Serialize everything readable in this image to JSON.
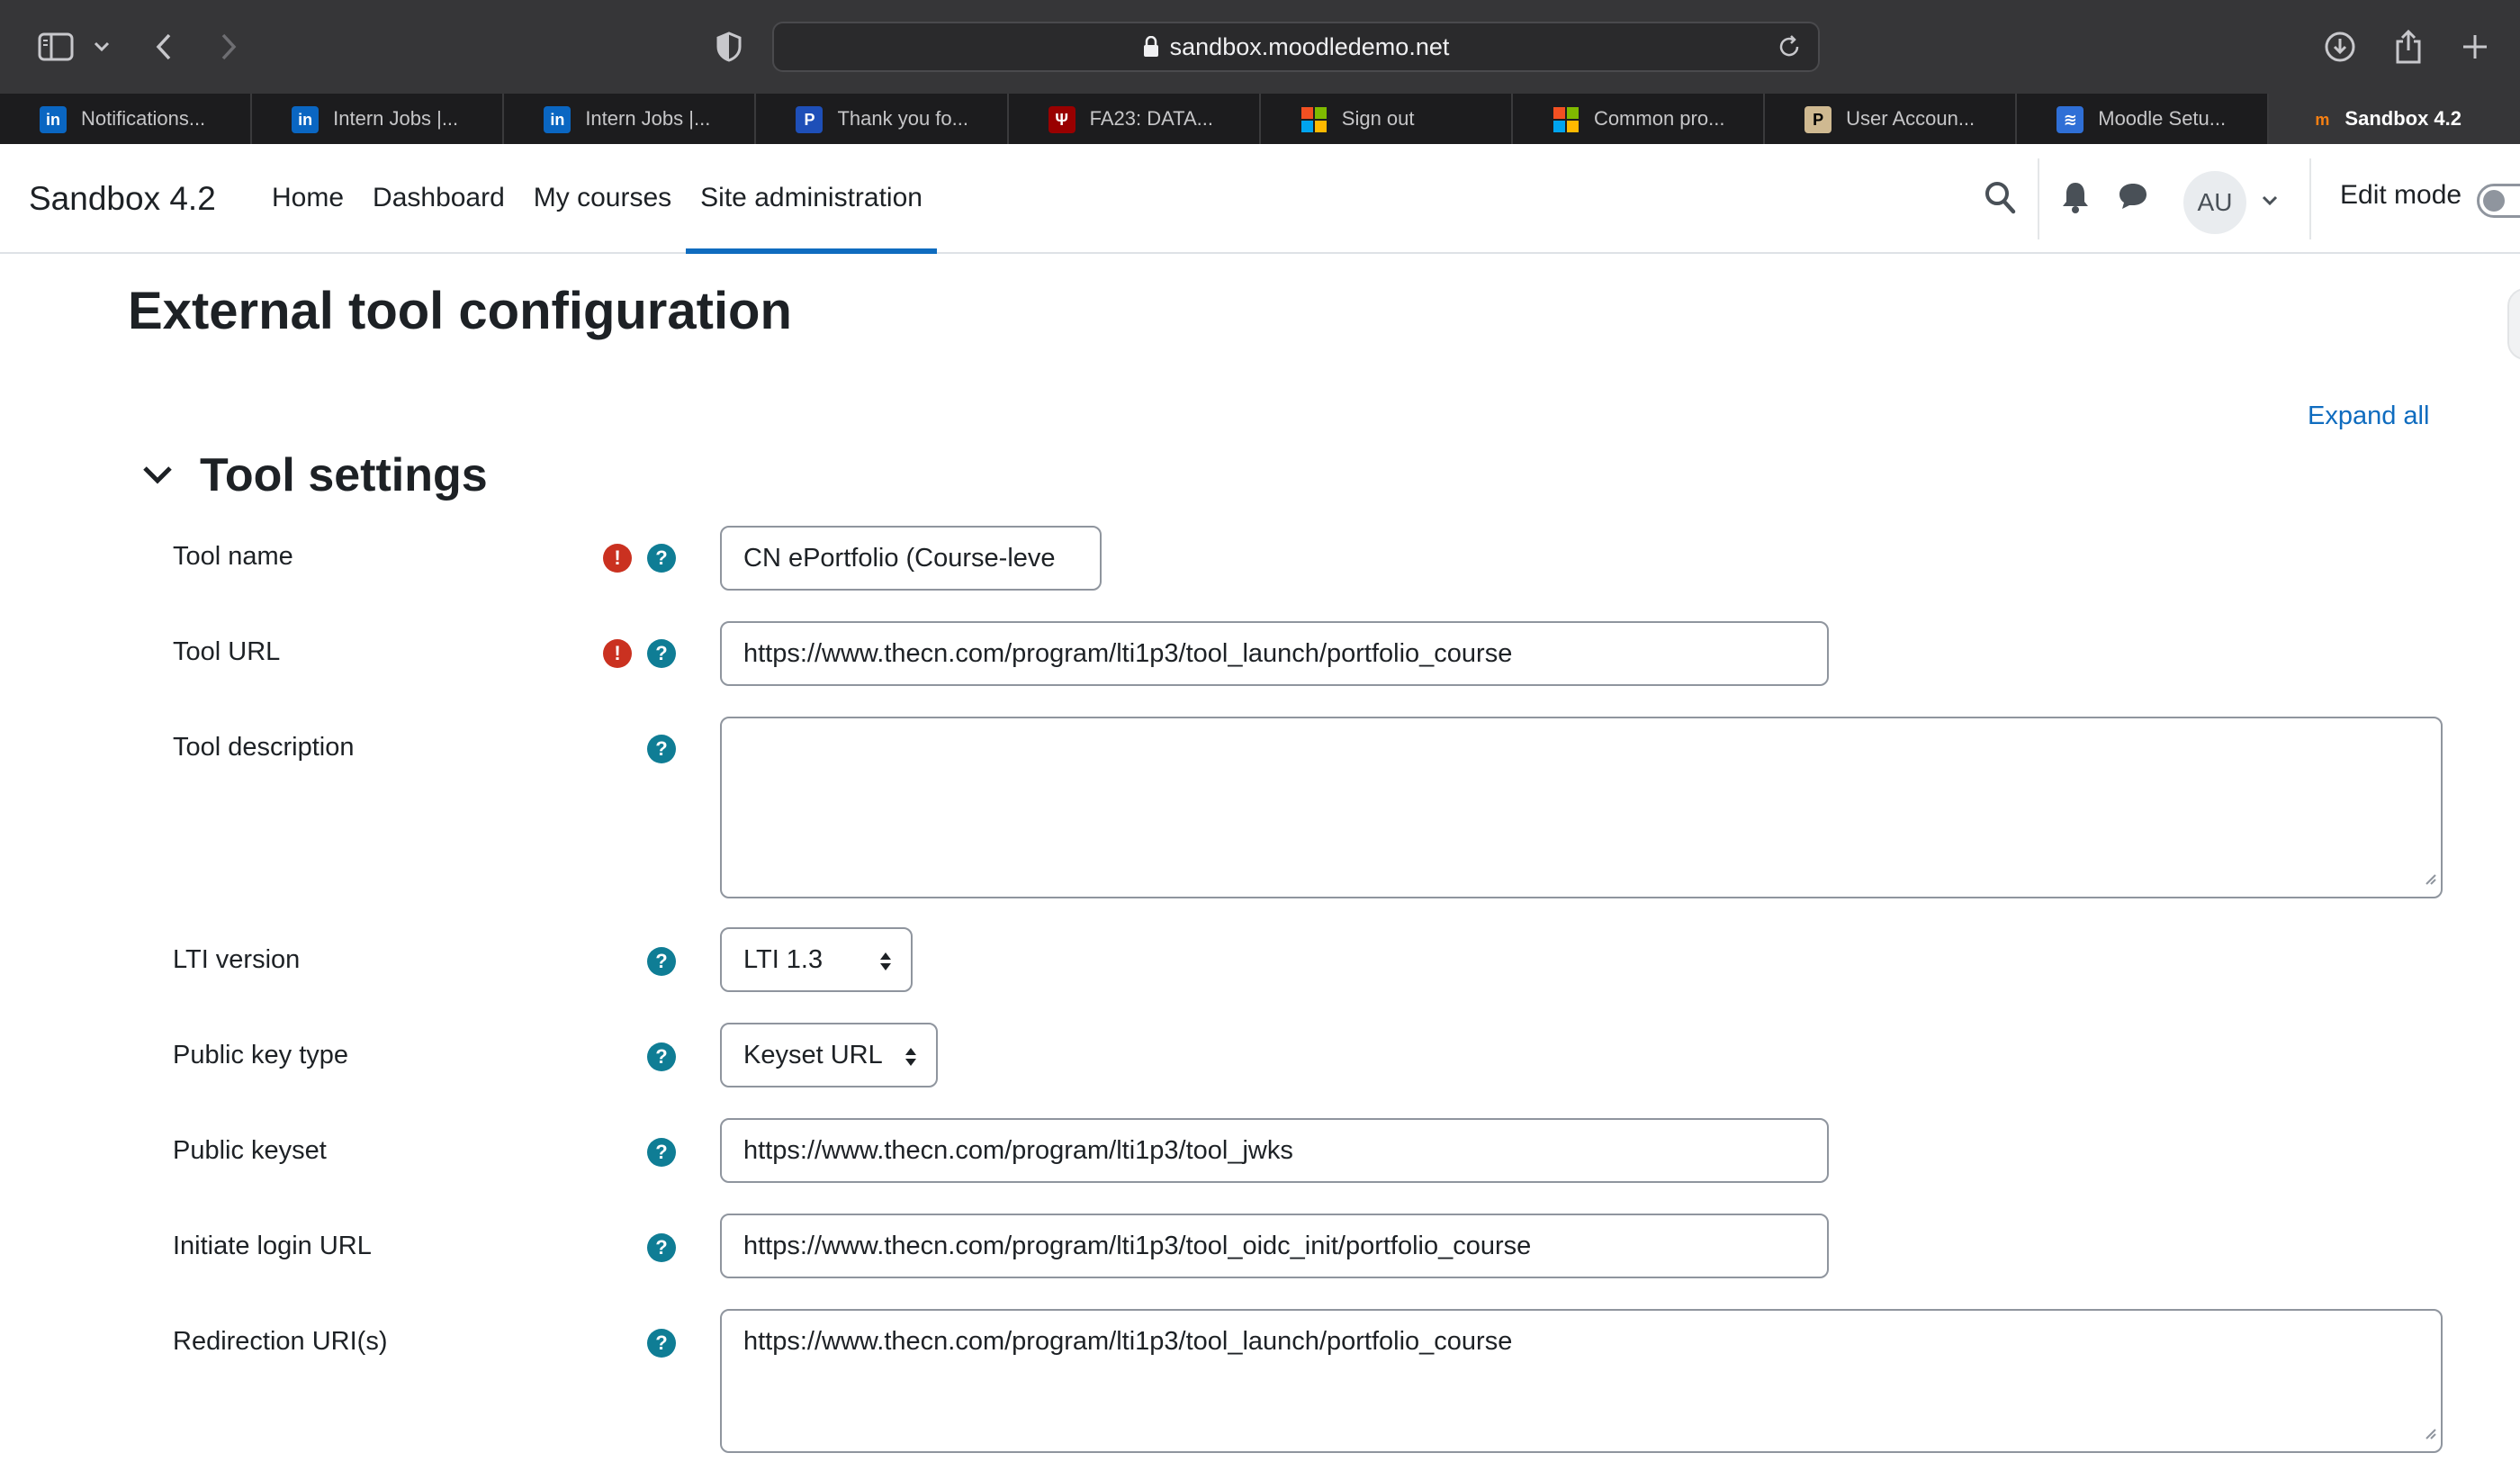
{
  "browser": {
    "url": "sandbox.moodledemo.net",
    "tabs": [
      {
        "label": "Notifications...",
        "favicon": "linkedin-icon",
        "color": "#0a66c2"
      },
      {
        "label": "Intern Jobs |...",
        "favicon": "linkedin-icon",
        "color": "#0a66c2"
      },
      {
        "label": "Intern Jobs |...",
        "favicon": "linkedin-icon",
        "color": "#0a66c2"
      },
      {
        "label": "Thank you fo...",
        "favicon": "paypal-icon",
        "color": "#1e4fb8"
      },
      {
        "label": "FA23: DATA...",
        "favicon": "iu-trident-icon",
        "color": "#990000"
      },
      {
        "label": "Sign out",
        "favicon": "microsoft-icon",
        "color": "#f25022"
      },
      {
        "label": "Common pro...",
        "favicon": "microsoft-icon",
        "color": "#f25022"
      },
      {
        "label": "User Accoun...",
        "favicon": "purdue-icon",
        "color": "#cfb991"
      },
      {
        "label": "Moodle Setu...",
        "favicon": "stack-icon",
        "color": "#2f6fd6"
      },
      {
        "label": "Sandbox 4.2",
        "favicon": "moodle-icon",
        "color": "#f98012",
        "active": true
      }
    ]
  },
  "navbar": {
    "brand": "Sandbox 4.2",
    "links": [
      {
        "label": "Home"
      },
      {
        "label": "Dashboard"
      },
      {
        "label": "My courses"
      },
      {
        "label": "Site administration",
        "active": true
      }
    ],
    "avatar_initials": "AU",
    "edit_mode_label": "Edit mode",
    "edit_mode_on": false
  },
  "page": {
    "title": "External tool configuration",
    "expand_all": "Expand all",
    "section_title": "Tool settings"
  },
  "fields": {
    "tool_name": {
      "label": "Tool name",
      "value": "CN ePortfolio (Course-leve",
      "required": true
    },
    "tool_url": {
      "label": "Tool URL",
      "value": "https://www.thecn.com/program/lti1p3/tool_launch/portfolio_course",
      "required": true
    },
    "tool_description": {
      "label": "Tool description",
      "value": ""
    },
    "lti_version": {
      "label": "LTI version",
      "value": "LTI 1.3"
    },
    "public_key_type": {
      "label": "Public key type",
      "value": "Keyset URL"
    },
    "public_keyset": {
      "label": "Public keyset",
      "value": "https://www.thecn.com/program/lti1p3/tool_jwks"
    },
    "initiate_login_url": {
      "label": "Initiate login URL",
      "value": "https://www.thecn.com/program/lti1p3/tool_oidc_init/portfolio_course"
    },
    "redirection_uris": {
      "label": "Redirection URI(s)",
      "value": "https://www.thecn.com/program/lti1p3/tool_launch/portfolio_course"
    }
  },
  "colors": {
    "accent": "#0f6cbf",
    "required": "#ca3120",
    "help": "#0f7d95"
  }
}
